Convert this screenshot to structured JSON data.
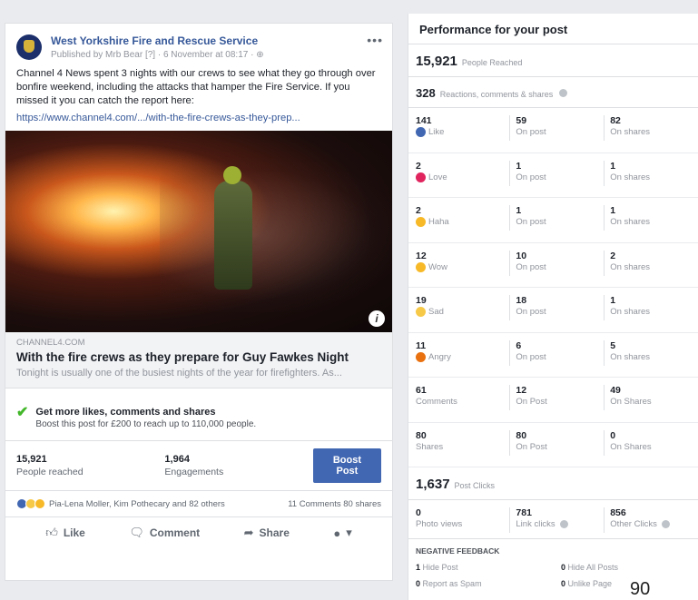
{
  "post": {
    "page_name": "West Yorkshire Fire and Rescue Service",
    "meta": "Published by Mrb Bear [?] · 6 November at 08:17 · ⊕",
    "text": "Channel 4 News spent 3 nights with our crews to see what they go through over bonfire weekend, including the attacks that hamper the Fire Service. If you missed it you can catch the report here:",
    "link": "https://www.channel4.com/.../with-the-fire-crews-as-they-prep...",
    "link_domain": "CHANNEL4.COM",
    "link_title": "With the fire crews as they prepare for Guy Fawkes Night",
    "link_desc": "Tonight is usually one of the busiest nights of the year for firefighters. As...",
    "promo_title": "Get more likes, comments and shares",
    "promo_sub": "Boost this post for £200 to reach up to 110,000 people.",
    "reached_num": "15,921",
    "reached_lbl": "People reached",
    "engage_num": "1,964",
    "engage_lbl": "Engagements",
    "boost_label": "Boost Post",
    "reaction_names": "Pia-Lena Moller, Kim Pothecary and 82 others",
    "comments_shares": "11 Comments  80 shares",
    "like": "Like",
    "comment": "Comment",
    "share": "Share"
  },
  "perf": {
    "title": "Performance for your post",
    "reached_num": "15,921",
    "reached_lbl": "People Reached",
    "rcs_num": "328",
    "rcs_lbl": "Reactions, comments & shares",
    "rows": [
      {
        "total": "141",
        "label": "Like",
        "on_post": "59",
        "on_post_lbl": "On post",
        "on_shares": "82",
        "on_shares_lbl": "On shares",
        "color": "#4267b2"
      },
      {
        "total": "2",
        "label": "Love",
        "on_post": "1",
        "on_post_lbl": "On post",
        "on_shares": "1",
        "on_shares_lbl": "On shares",
        "color": "#e0245e"
      },
      {
        "total": "2",
        "label": "Haha",
        "on_post": "1",
        "on_post_lbl": "On post",
        "on_shares": "1",
        "on_shares_lbl": "On shares",
        "color": "#f7b928"
      },
      {
        "total": "12",
        "label": "Wow",
        "on_post": "10",
        "on_post_lbl": "On post",
        "on_shares": "2",
        "on_shares_lbl": "On shares",
        "color": "#f7b928"
      },
      {
        "total": "19",
        "label": "Sad",
        "on_post": "18",
        "on_post_lbl": "On post",
        "on_shares": "1",
        "on_shares_lbl": "On shares",
        "color": "#f7c948"
      },
      {
        "total": "11",
        "label": "Angry",
        "on_post": "6",
        "on_post_lbl": "On post",
        "on_shares": "5",
        "on_shares_lbl": "On shares",
        "color": "#e9710f"
      },
      {
        "total": "61",
        "label": "Comments",
        "on_post": "12",
        "on_post_lbl": "On Post",
        "on_shares": "49",
        "on_shares_lbl": "On Shares",
        "color": ""
      },
      {
        "total": "80",
        "label": "Shares",
        "on_post": "80",
        "on_post_lbl": "On Post",
        "on_shares": "0",
        "on_shares_lbl": "On Shares",
        "color": ""
      }
    ],
    "post_clicks_num": "1,637",
    "post_clicks_lbl": "Post Clicks",
    "photo_views_num": "0",
    "photo_views_lbl": "Photo views",
    "link_clicks_num": "781",
    "link_clicks_lbl": "Link clicks",
    "other_clicks_num": "856",
    "other_clicks_lbl": "Other Clicks",
    "neg_title": "NEGATIVE FEEDBACK",
    "hide_post_num": "1",
    "hide_post_lbl": "Hide Post",
    "hide_all_num": "0",
    "hide_all_lbl": "Hide All Posts",
    "spam_num": "0",
    "spam_lbl": "Report as Spam",
    "unlike_num": "0",
    "unlike_lbl": "Unlike Page"
  },
  "page_number": "90"
}
